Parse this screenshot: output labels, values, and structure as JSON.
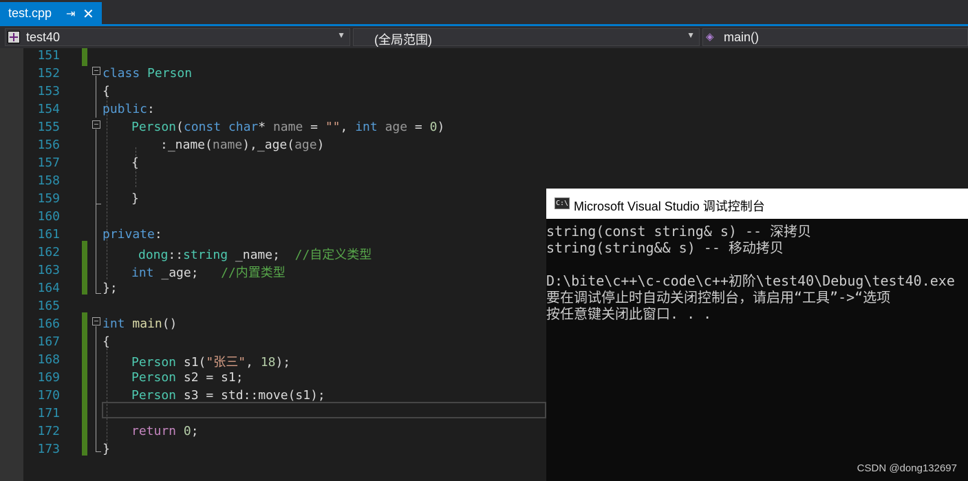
{
  "tab": {
    "label": "test.cpp",
    "pin": "⇥",
    "close": "✕"
  },
  "navbar": {
    "project": "test40",
    "scope": "(全局范围)",
    "member": "main()"
  },
  "code_lines": [
    {
      "num": "151"
    },
    {
      "num": "152",
      "parts": [
        {
          "t": "class",
          "c": "k"
        },
        {
          "t": " "
        },
        {
          "t": "Person",
          "c": "t"
        }
      ]
    },
    {
      "num": "153",
      "parts": [
        {
          "t": "{"
        }
      ]
    },
    {
      "num": "154",
      "parts": [
        {
          "t": "public",
          "c": "k"
        },
        {
          "t": ":"
        }
      ]
    },
    {
      "num": "155",
      "parts": [
        {
          "t": "Person",
          "c": "t"
        },
        {
          "t": "("
        },
        {
          "t": "const",
          "c": "k"
        },
        {
          "t": " "
        },
        {
          "t": "char",
          "c": "k"
        },
        {
          "t": "* "
        },
        {
          "t": "name",
          "c": "p"
        },
        {
          "t": " = "
        },
        {
          "t": "\"\"",
          "c": "s"
        },
        {
          "t": ", "
        },
        {
          "t": "int",
          "c": "k"
        },
        {
          "t": " "
        },
        {
          "t": "age",
          "c": "p"
        },
        {
          "t": " = "
        },
        {
          "t": "0",
          "c": "n"
        },
        {
          "t": ")"
        }
      ]
    },
    {
      "num": "156",
      "parts": [
        {
          "t": ":_name("
        },
        {
          "t": "name",
          "c": "p"
        },
        {
          "t": "),_age("
        },
        {
          "t": "age",
          "c": "p"
        },
        {
          "t": ")"
        }
      ]
    },
    {
      "num": "157",
      "parts": [
        {
          "t": "{"
        }
      ]
    },
    {
      "num": "158"
    },
    {
      "num": "159",
      "parts": [
        {
          "t": "}"
        }
      ]
    },
    {
      "num": "160"
    },
    {
      "num": "161",
      "parts": [
        {
          "t": "private",
          "c": "k"
        },
        {
          "t": ":"
        }
      ]
    },
    {
      "num": "162",
      "parts": [
        {
          "t": "dong",
          "c": "t"
        },
        {
          "t": "::"
        },
        {
          "t": "string",
          "c": "t"
        },
        {
          "t": " _name;  "
        },
        {
          "t": "//自定义类型",
          "c": "c"
        }
      ]
    },
    {
      "num": "163",
      "parts": [
        {
          "t": "int",
          "c": "k"
        },
        {
          "t": " _age;   "
        },
        {
          "t": "//内置类型",
          "c": "c"
        }
      ]
    },
    {
      "num": "164",
      "parts": [
        {
          "t": "};"
        }
      ]
    },
    {
      "num": "165"
    },
    {
      "num": "166",
      "parts": [
        {
          "t": "int",
          "c": "k"
        },
        {
          "t": " "
        },
        {
          "t": "main",
          "c": "f"
        },
        {
          "t": "()"
        }
      ]
    },
    {
      "num": "167",
      "parts": [
        {
          "t": "{"
        }
      ]
    },
    {
      "num": "168",
      "parts": [
        {
          "t": "Person",
          "c": "t"
        },
        {
          "t": " s1("
        },
        {
          "t": "\"张三\"",
          "c": "s"
        },
        {
          "t": ", "
        },
        {
          "t": "18",
          "c": "n"
        },
        {
          "t": ");"
        }
      ]
    },
    {
      "num": "169",
      "parts": [
        {
          "t": "Person",
          "c": "t"
        },
        {
          "t": " s2 = s1;"
        }
      ]
    },
    {
      "num": "170",
      "parts": [
        {
          "t": "Person",
          "c": "t"
        },
        {
          "t": " s3 = std::move(s1);"
        }
      ]
    },
    {
      "num": "171"
    },
    {
      "num": "172",
      "parts": [
        {
          "t": "return",
          "c": "v"
        },
        {
          "t": " "
        },
        {
          "t": "0",
          "c": "n"
        },
        {
          "t": ";"
        }
      ]
    },
    {
      "num": "173",
      "parts": [
        {
          "t": "}"
        }
      ]
    }
  ],
  "console": {
    "title": "Microsoft Visual Studio 调试控制台",
    "icon": "C:\\",
    "lines": [
      "string(const string& s) -- 深拷贝",
      "string(string&& s) -- 移动拷贝",
      "",
      "D:\\bite\\c++\\c-code\\c++初阶\\test40\\Debug\\test40.exe",
      "要在调试停止时自动关闭控制台，请启用“工具”->“选项",
      "按任意键关闭此窗口. . ."
    ]
  },
  "watermark": "CSDN @dong132697",
  "colors": {
    "accent": "#007acc",
    "keyword": "#569cd6",
    "type": "#4ec9b0",
    "comment": "#57a64a",
    "change_bar": "#487e1f"
  }
}
